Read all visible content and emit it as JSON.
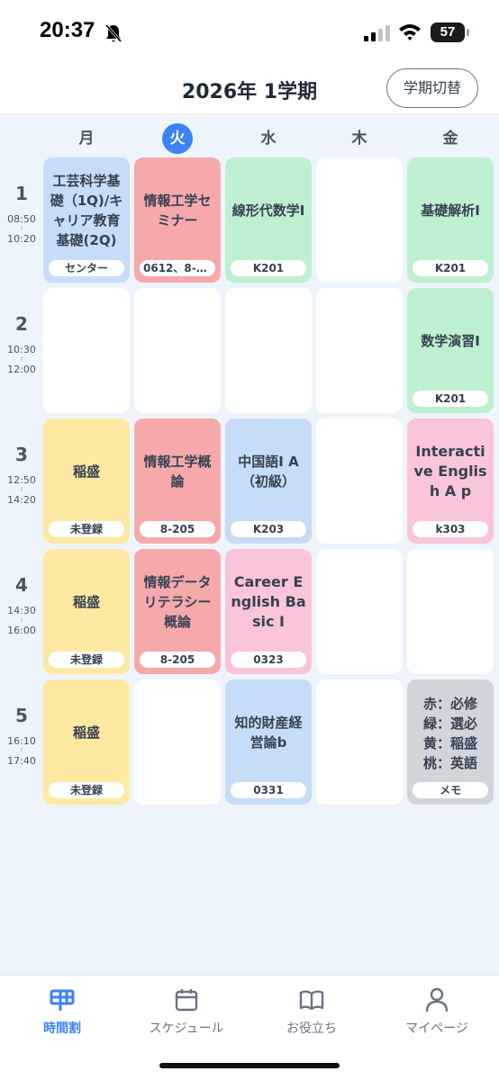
{
  "status_bar": {
    "time": "20:37",
    "battery": "57"
  },
  "header": {
    "title": "2026年 1学期",
    "term_switch_label": "学期切替"
  },
  "days": [
    {
      "label": "月",
      "today": false
    },
    {
      "label": "火",
      "today": true
    },
    {
      "label": "水",
      "today": false
    },
    {
      "label": "木",
      "today": false
    },
    {
      "label": "金",
      "today": false
    }
  ],
  "periods": [
    {
      "num": "1",
      "start": "08:50",
      "end": "10:20"
    },
    {
      "num": "2",
      "start": "10:30",
      "end": "12:00"
    },
    {
      "num": "3",
      "start": "12:50",
      "end": "14:20"
    },
    {
      "num": "4",
      "start": "14:30",
      "end": "16:00"
    },
    {
      "num": "5",
      "start": "16:10",
      "end": "17:40"
    }
  ],
  "grid": [
    [
      {
        "name": "工芸科学基礎（1Q)/キャリア教育基礎(2Q)",
        "room": "センター",
        "color": "blue"
      },
      {
        "name": "情報工学セミナー",
        "room": "0612、8-2…",
        "color": "red"
      },
      {
        "name": "線形代数学I",
        "room": "K201",
        "color": "green"
      },
      null,
      {
        "name": "基礎解析I",
        "room": "K201",
        "color": "green"
      }
    ],
    [
      null,
      null,
      null,
      null,
      {
        "name": "数学演習I",
        "room": "K201",
        "color": "green"
      }
    ],
    [
      {
        "name": "稲盛",
        "room": "未登録",
        "color": "yellow"
      },
      {
        "name": "情報工学概論",
        "room": "8-205",
        "color": "red"
      },
      {
        "name": "中国語I A（初級）",
        "room": "K203",
        "color": "blue"
      },
      null,
      {
        "name": "Interactive English A p",
        "room": "k303",
        "color": "pink",
        "en": true
      }
    ],
    [
      {
        "name": "稲盛",
        "room": "未登録",
        "color": "yellow"
      },
      {
        "name": "情報データリテラシー概論",
        "room": "8-205",
        "color": "red"
      },
      {
        "name": "Career English Basic I",
        "room": "0323",
        "color": "pink",
        "en": true
      },
      null,
      null
    ],
    [
      {
        "name": "稲盛",
        "room": "未登録",
        "color": "yellow"
      },
      null,
      {
        "name": "知的財産経営論b",
        "room": "0331",
        "color": "blue"
      },
      null,
      {
        "memo": [
          "赤：必修",
          "緑：選必",
          "黄：稲盛",
          "桃：英語"
        ],
        "room": "メモ",
        "color": "gray"
      }
    ]
  ],
  "colors": {
    "accent": "#3b82f6",
    "blue": "#c7dcf8",
    "red": "#f5a9ab",
    "green": "#bdf0cf",
    "yellow": "#fde9a2",
    "pink": "#fac4da",
    "gray": "#d1d5db",
    "background": "#eef4fc"
  },
  "nav": [
    {
      "label": "時間割",
      "icon": "timetable-icon",
      "active": true
    },
    {
      "label": "スケジュール",
      "icon": "calendar-icon",
      "active": false
    },
    {
      "label": "お役立ち",
      "icon": "book-icon",
      "active": false
    },
    {
      "label": "マイページ",
      "icon": "person-icon",
      "active": false
    }
  ]
}
